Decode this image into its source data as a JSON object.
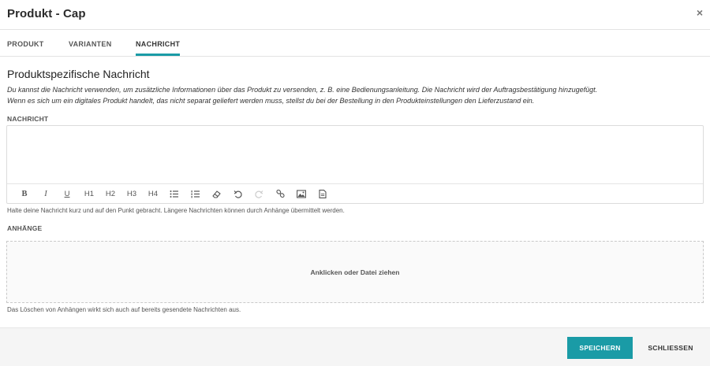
{
  "header": {
    "title": "Produkt - Cap",
    "close_symbol": "×"
  },
  "tabs": [
    {
      "label": "PRODUKT"
    },
    {
      "label": "VARIANTEN"
    },
    {
      "label": "NACHRICHT",
      "active": true
    }
  ],
  "message_section": {
    "title": "Produktspezifische Nachricht",
    "description_line1": "Du kannst die Nachricht verwenden, um zusätzliche Informationen über das Produkt zu versenden, z. B. eine Bedienungsanleitung. Die Nachricht wird der Auftragsbestätigung hinzugefügt.",
    "description_line2": "Wenn es sich um ein digitales Produkt handelt, das nicht separat geliefert werden muss, stellst du bei der Bestellung in den Produkteinstellungen den Lieferzustand ein.",
    "field_label": "NACHRICHT",
    "editor_value": "",
    "hint": "Halte deine Nachricht kurz und auf den Punkt gebracht. Längere Nachrichten können durch Anhänge übermittelt werden."
  },
  "toolbar": {
    "bold": "B",
    "italic": "I",
    "underline": "U",
    "h1": "H1",
    "h2": "H2",
    "h3": "H3",
    "h4": "H4",
    "icons": [
      "bullet-list-icon",
      "numbered-list-icon",
      "eraser-icon",
      "undo-icon",
      "redo-icon",
      "link-icon",
      "image-icon",
      "document-icon"
    ]
  },
  "attachments": {
    "label": "ANHÄNGE",
    "dropzone_text": "Anklicken oder Datei ziehen",
    "hint": "Das Löschen von Anhängen wirkt sich auch auf bereits gesendete Nachrichten aus."
  },
  "footer": {
    "save_label": "SPEICHERN",
    "close_label": "SCHLIESSEN"
  },
  "colors": {
    "accent": "#1a9ba6"
  }
}
